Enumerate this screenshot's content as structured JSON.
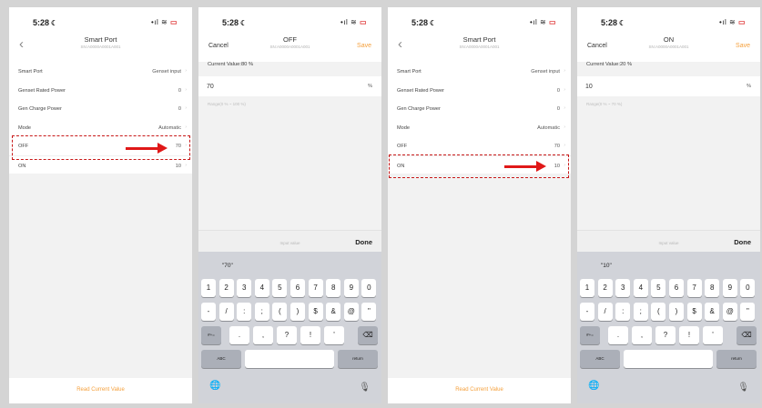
{
  "status_bar": {
    "time": "5:28",
    "signal": "•ıl",
    "wifi": "≋",
    "battery": "▭"
  },
  "screen1": {
    "title": "Smart Port",
    "subtitle": "SN:A0000A0001A001",
    "rows": [
      {
        "label": "Smart Port",
        "value": "Genset input"
      },
      {
        "label": "Genset Rated Power",
        "value": "0"
      },
      {
        "label": "Gen Charge Power",
        "value": "0"
      },
      {
        "label": "Mode",
        "value": "Automatic"
      },
      {
        "label": "OFF",
        "value": "70"
      },
      {
        "label": "ON",
        "value": "10"
      }
    ],
    "highlight_row": "OFF",
    "read_button": "Read Current Value"
  },
  "screen2": {
    "cancel": "Cancel",
    "title": "OFF",
    "subtitle": "SN:A0000A0001A001",
    "save": "Save",
    "current_value": "Current Value:80 %",
    "input_value": "70",
    "unit": "%",
    "range": "Range(0 % ~ 100 %)",
    "placeholder": "Input value",
    "done": "Done",
    "suggestion": "\"70\""
  },
  "screen3": {
    "title": "Smart Port",
    "subtitle": "SN:A0000A0001A001",
    "rows": [
      {
        "label": "Smart Port",
        "value": "Genset input"
      },
      {
        "label": "Genset Rated Power",
        "value": "0"
      },
      {
        "label": "Gen Charge Power",
        "value": "0"
      },
      {
        "label": "Mode",
        "value": "Automatic"
      },
      {
        "label": "OFF",
        "value": "70"
      },
      {
        "label": "ON",
        "value": "10"
      }
    ],
    "highlight_row": "ON",
    "read_button": "Read Current Value"
  },
  "screen4": {
    "cancel": "Cancel",
    "title": "ON",
    "subtitle": "SN:A0000A0001A001",
    "save": "Save",
    "current_value": "Current Value:20 %",
    "input_value": "10",
    "unit": "%",
    "range": "Range(0 % ~ 70 %)",
    "placeholder": "Input value",
    "done": "Done",
    "suggestion": "\"10\""
  },
  "keyboard": {
    "row1": [
      "1",
      "2",
      "3",
      "4",
      "5",
      "6",
      "7",
      "8",
      "9",
      "0"
    ],
    "row2": [
      "-",
      "/",
      ":",
      ";",
      "(",
      ")",
      "$",
      "&",
      "@",
      "\""
    ],
    "row3_toggle": "#+=",
    "row3": [
      ".",
      ",",
      "?",
      "!",
      "'"
    ],
    "row3_delete": "⌫",
    "abc": "ABC",
    "return": "return",
    "globe": "🌐",
    "mic": "🎙"
  },
  "colors": {
    "accent": "#f5a03c",
    "highlight": "#c81818",
    "arrow": "#e01818"
  }
}
